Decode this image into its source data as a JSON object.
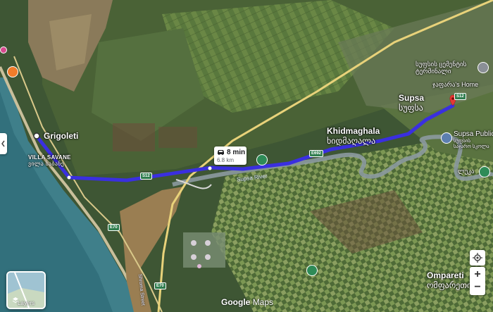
{
  "places": {
    "grigoleti": "Grigoleti",
    "villa_savane": "VILLA SAVANE",
    "villa_savane_ka": "ვილა საბანე",
    "khidmaghala": "Khidmaghala",
    "khidmaghala_ka": "ხიდმაღალა",
    "supsa": "Supsa",
    "supsa_ka": "სუფსა",
    "supsa_cemetery_ka": "სუფსის ცემენტის",
    "supsa_cemetery_ka2": "ტერმინალი",
    "home": "ჯაფარა's Home",
    "supsa_public": "Supsa Public",
    "supsa_public_ka": "სუფსის",
    "supsa_public_ka2": "საჯარო სკოლა",
    "lisa": "ლუკა",
    "ompareti": "Ompareti",
    "ompareti_ka": "ომფარეთი",
    "supsa_river": "Supsa River",
    "street": "Shroma Street"
  },
  "road_shields": {
    "s12_west": "S12",
    "s12_east": "S12",
    "e692": "E692",
    "e70_north": "E70",
    "e70_south": "E70"
  },
  "route": {
    "time": "8 min",
    "distance": "6.8 km",
    "color": "#3a2fe0"
  },
  "controls": {
    "layers_label": "Layers",
    "zoom_in": "+",
    "zoom_out": "−"
  },
  "attribution": {
    "google": "Google",
    "maps": "Maps"
  }
}
